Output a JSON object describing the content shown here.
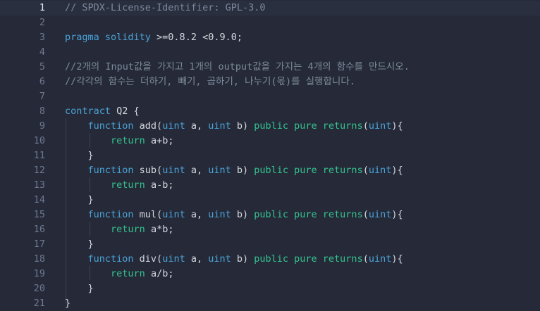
{
  "editor": {
    "lines": [
      {
        "n": "1",
        "tokens": [
          {
            "t": "// SPDX-License-Identifier: GPL-3.0",
            "c": "cm"
          }
        ]
      },
      {
        "n": "2",
        "tokens": []
      },
      {
        "n": "3",
        "tokens": [
          {
            "t": "pragma solidity",
            "c": "kw"
          },
          {
            "t": " >=0.8.2 <0.9.0;",
            "c": "tx"
          }
        ]
      },
      {
        "n": "4",
        "tokens": []
      },
      {
        "n": "5",
        "tokens": [
          {
            "t": "//2개의 Input값을 가지고 1개의 output값을 가지는 4개의 함수를 만드시오.",
            "c": "cm"
          }
        ]
      },
      {
        "n": "6",
        "tokens": [
          {
            "t": "//각각의 함수는 더하기, 빼기, 곱하기, 나누기(몫)를 실행합니다.",
            "c": "cm"
          }
        ]
      },
      {
        "n": "7",
        "tokens": []
      },
      {
        "n": "8",
        "tokens": [
          {
            "t": "contract",
            "c": "kw"
          },
          {
            "t": " Q2 {",
            "c": "tx"
          }
        ]
      },
      {
        "n": "9",
        "tokens": [
          {
            "t": "    ",
            "c": "tx"
          },
          {
            "t": "function",
            "c": "kw"
          },
          {
            "t": " add(",
            "c": "tx"
          },
          {
            "t": "uint",
            "c": "ty"
          },
          {
            "t": " a, ",
            "c": "tx"
          },
          {
            "t": "uint",
            "c": "ty"
          },
          {
            "t": " b) ",
            "c": "tx"
          },
          {
            "t": "public pure",
            "c": "mod"
          },
          {
            "t": " ",
            "c": "tx"
          },
          {
            "t": "returns",
            "c": "ret"
          },
          {
            "t": "(",
            "c": "tx"
          },
          {
            "t": "uint",
            "c": "ty"
          },
          {
            "t": "){",
            "c": "tx"
          }
        ]
      },
      {
        "n": "10",
        "tokens": [
          {
            "t": "        ",
            "c": "tx"
          },
          {
            "t": "return",
            "c": "ret"
          },
          {
            "t": " a+b;",
            "c": "tx"
          }
        ]
      },
      {
        "n": "11",
        "tokens": [
          {
            "t": "    }",
            "c": "tx"
          }
        ]
      },
      {
        "n": "12",
        "tokens": [
          {
            "t": "    ",
            "c": "tx"
          },
          {
            "t": "function",
            "c": "kw"
          },
          {
            "t": " sub(",
            "c": "tx"
          },
          {
            "t": "uint",
            "c": "ty"
          },
          {
            "t": " a, ",
            "c": "tx"
          },
          {
            "t": "uint",
            "c": "ty"
          },
          {
            "t": " b) ",
            "c": "tx"
          },
          {
            "t": "public pure",
            "c": "mod"
          },
          {
            "t": " ",
            "c": "tx"
          },
          {
            "t": "returns",
            "c": "ret"
          },
          {
            "t": "(",
            "c": "tx"
          },
          {
            "t": "uint",
            "c": "ty"
          },
          {
            "t": "){",
            "c": "tx"
          }
        ]
      },
      {
        "n": "13",
        "tokens": [
          {
            "t": "        ",
            "c": "tx"
          },
          {
            "t": "return",
            "c": "ret"
          },
          {
            "t": " a-b;",
            "c": "tx"
          }
        ]
      },
      {
        "n": "14",
        "tokens": [
          {
            "t": "    }",
            "c": "tx"
          }
        ]
      },
      {
        "n": "15",
        "tokens": [
          {
            "t": "    ",
            "c": "tx"
          },
          {
            "t": "function",
            "c": "kw"
          },
          {
            "t": " mul(",
            "c": "tx"
          },
          {
            "t": "uint",
            "c": "ty"
          },
          {
            "t": " a, ",
            "c": "tx"
          },
          {
            "t": "uint",
            "c": "ty"
          },
          {
            "t": " b) ",
            "c": "tx"
          },
          {
            "t": "public pure",
            "c": "mod"
          },
          {
            "t": " ",
            "c": "tx"
          },
          {
            "t": "returns",
            "c": "ret"
          },
          {
            "t": "(",
            "c": "tx"
          },
          {
            "t": "uint",
            "c": "ty"
          },
          {
            "t": "){",
            "c": "tx"
          }
        ]
      },
      {
        "n": "16",
        "tokens": [
          {
            "t": "        ",
            "c": "tx"
          },
          {
            "t": "return",
            "c": "ret"
          },
          {
            "t": " a*b;",
            "c": "tx"
          }
        ]
      },
      {
        "n": "17",
        "tokens": [
          {
            "t": "    }",
            "c": "tx"
          }
        ]
      },
      {
        "n": "18",
        "tokens": [
          {
            "t": "    ",
            "c": "tx"
          },
          {
            "t": "function",
            "c": "kw"
          },
          {
            "t": " div(",
            "c": "tx"
          },
          {
            "t": "uint",
            "c": "ty"
          },
          {
            "t": " a, ",
            "c": "tx"
          },
          {
            "t": "uint",
            "c": "ty"
          },
          {
            "t": " b) ",
            "c": "tx"
          },
          {
            "t": "public pure",
            "c": "mod"
          },
          {
            "t": " ",
            "c": "tx"
          },
          {
            "t": "returns",
            "c": "ret"
          },
          {
            "t": "(",
            "c": "tx"
          },
          {
            "t": "uint",
            "c": "ty"
          },
          {
            "t": "){",
            "c": "tx"
          }
        ]
      },
      {
        "n": "19",
        "tokens": [
          {
            "t": "        ",
            "c": "tx"
          },
          {
            "t": "return",
            "c": "ret"
          },
          {
            "t": " a/b;",
            "c": "tx"
          }
        ]
      },
      {
        "n": "20",
        "tokens": [
          {
            "t": "    }",
            "c": "tx"
          }
        ]
      },
      {
        "n": "21",
        "tokens": [
          {
            "t": "}",
            "c": "tx"
          }
        ]
      }
    ],
    "active_line": "1"
  },
  "colors": {
    "background": "#262a38",
    "keyword": "#4aa3d8",
    "modifier": "#34c38f",
    "comment": "#7b8a99",
    "text": "#d4d7de"
  }
}
